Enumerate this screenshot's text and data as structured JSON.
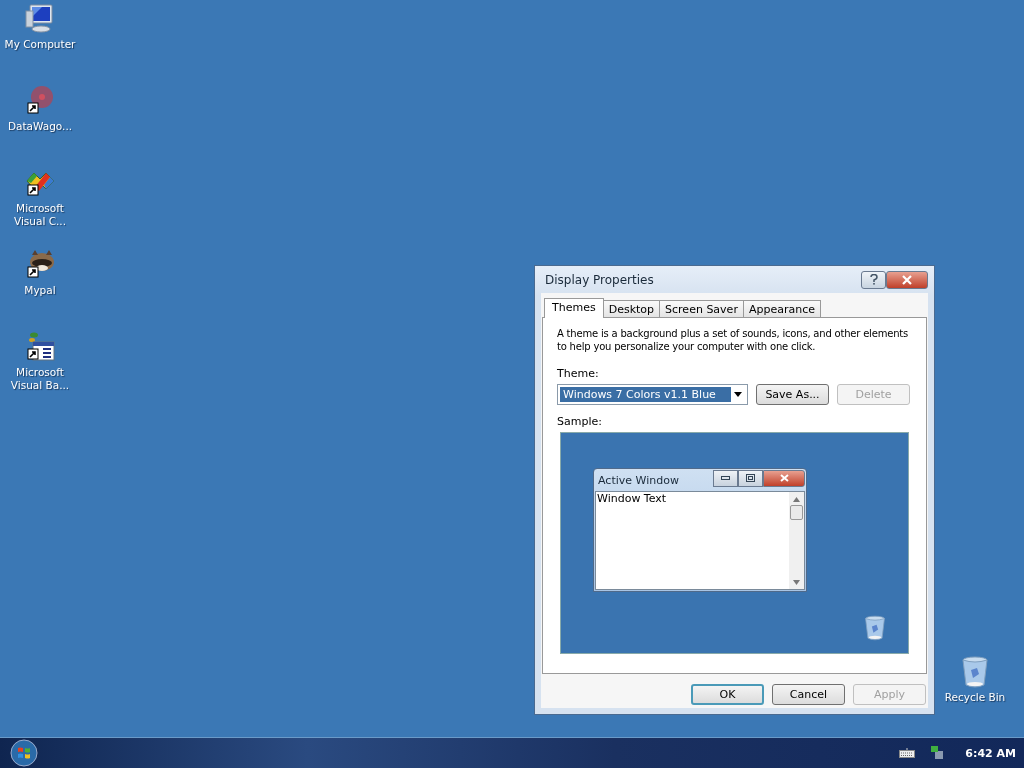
{
  "desktop_icons": [
    {
      "label": "My Computer",
      "kind": "computer",
      "shortcut": false
    },
    {
      "label": "DataWago...",
      "kind": "disc",
      "shortcut": true
    },
    {
      "label": "Microsoft Visual C...",
      "kind": "studio",
      "shortcut": true
    },
    {
      "label": "Mypal",
      "kind": "raccoon",
      "shortcut": true
    },
    {
      "label": "Microsoft Visual Ba...",
      "kind": "basic",
      "shortcut": true
    }
  ],
  "recycle_bin": {
    "label": "Recycle Bin"
  },
  "dialog": {
    "title": "Display Properties",
    "tabs": [
      {
        "label": "Themes",
        "selected": true
      },
      {
        "label": "Desktop",
        "selected": false
      },
      {
        "label": "Screen Saver",
        "selected": false
      },
      {
        "label": "Appearance",
        "selected": false
      }
    ],
    "description": "A theme is a background plus a set of sounds, icons, and other elements to help you personalize your computer with one click.",
    "theme_label": "Theme:",
    "theme_value": "Windows 7 Colors v1.1 Blue",
    "theme_buttons": [
      {
        "label": "Save As...",
        "disabled": false
      },
      {
        "label": "Delete",
        "disabled": true
      }
    ],
    "sample_label": "Sample:",
    "sample": {
      "window_title": "Active Window",
      "window_text": "Window Text"
    },
    "footer_buttons": [
      {
        "label": "OK",
        "disabled": false,
        "default": true
      },
      {
        "label": "Cancel",
        "disabled": false,
        "default": false
      },
      {
        "label": "Apply",
        "disabled": true,
        "default": false
      }
    ]
  },
  "taskbar": {
    "clock": "6:42 AM"
  }
}
